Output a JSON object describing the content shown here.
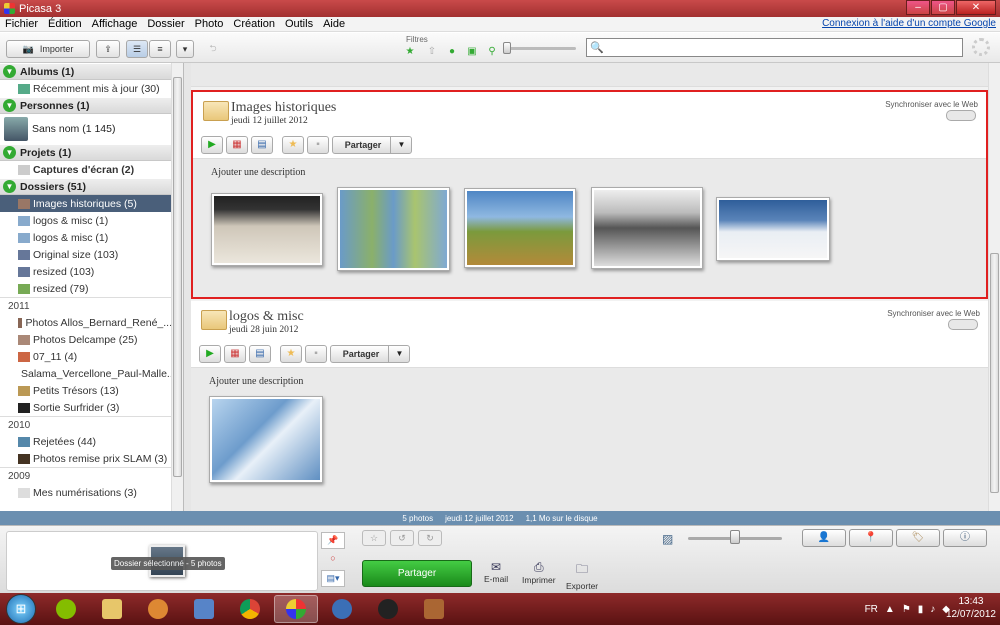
{
  "window": {
    "title": "Picasa 3"
  },
  "menu": {
    "items": [
      "Fichier",
      "Édition",
      "Affichage",
      "Dossier",
      "Photo",
      "Création",
      "Outils",
      "Aide"
    ],
    "login_link": "Connexion à l'aide d'un compte Google"
  },
  "toolbar": {
    "import_label": "Importer",
    "filters_label": "Filtres",
    "search_value": ""
  },
  "sidebar": {
    "albums_header": "Albums (1)",
    "albums": [
      "Récemment mis à jour (30)"
    ],
    "people_header": "Personnes (1)",
    "people": [
      "Sans nom (1 145)"
    ],
    "projects_header": "Projets (1)",
    "projects": [
      "Captures d'écran (2)"
    ],
    "folders_header": "Dossiers (51)",
    "folders_top": [
      "Images historiques (5)",
      "logos & misc (1)",
      "logos & misc (1)",
      "Original size (103)",
      "resized (103)",
      "resized (79)"
    ],
    "year_2011": "2011",
    "folders_2011": [
      "Photos Allos_Bernard_René_...",
      "Photos Delcampe (25)",
      "07_11 (4)",
      "Salama_Vercellone_Paul-Malle...",
      "Petits Trésors (13)",
      "Sortie Surfrider (3)"
    ],
    "year_2010": "2010",
    "folders_2010": [
      "Rejetées (44)",
      "Photos remise prix  SLAM (3)"
    ],
    "year_2009": "2009",
    "folders_2009": [
      "Mes numérisations (3)"
    ]
  },
  "albums": [
    {
      "name": "Images historiques",
      "date": "jeudi 12 juillet 2012",
      "sync": "Synchroniser avec le Web",
      "share": "Partager",
      "description": "Ajouter une description"
    },
    {
      "name": "logos & misc",
      "date": "jeudi 28 juin 2012",
      "sync": "Synchroniser avec le Web",
      "share": "Partager",
      "description": "Ajouter une description"
    }
  ],
  "statusbar": {
    "count": "5 photos",
    "date": "jeudi 12 juillet 2012",
    "size": "1,1 Mo sur le disque"
  },
  "tray": {
    "selection_label": "Dossier sélectionné - 5 photos",
    "share_label": "Partager",
    "email_label": "E-mail",
    "print_label": "Imprimer",
    "export_label": "Exporter"
  },
  "taskbar": {
    "lang": "FR",
    "time": "13:43",
    "date": "12/07/2012"
  },
  "colors": {
    "titlebar": "#a23030",
    "selection": "#4a5f7a",
    "highlight_border": "#e02020",
    "share_green": "#2a9a2a",
    "statusbar": "#6b8fb0"
  }
}
